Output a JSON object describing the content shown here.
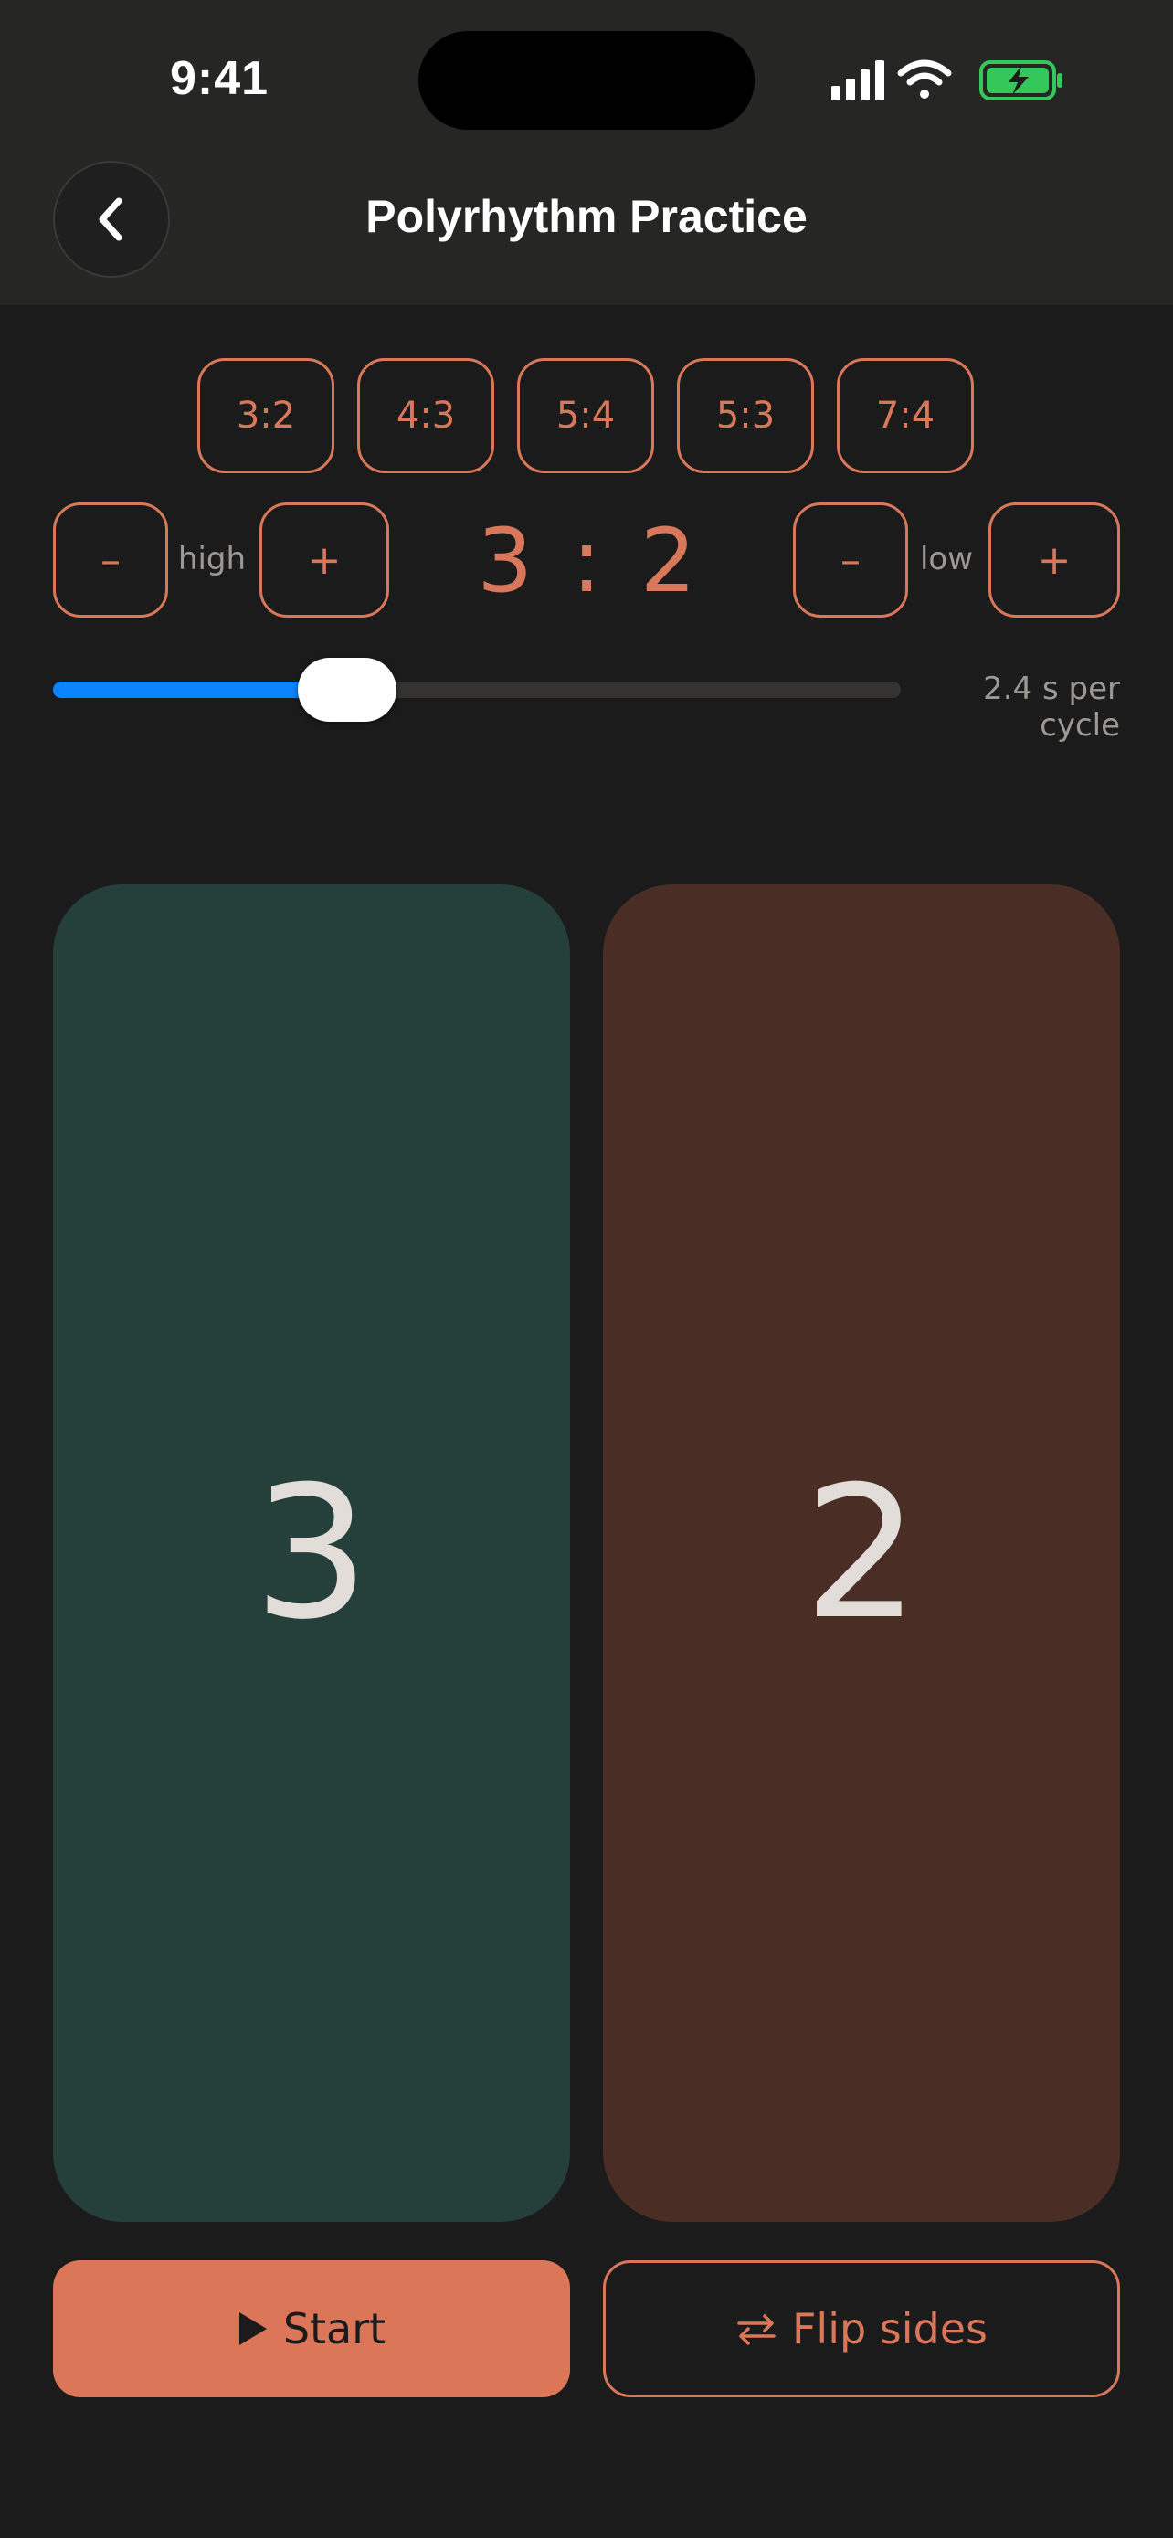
{
  "status_bar": {
    "time": "9:41"
  },
  "header": {
    "title": "Polyrhythm Practice",
    "back_icon": "chevron-left-icon"
  },
  "presets": [
    "3:2",
    "4:3",
    "5:4",
    "5:3",
    "7:4"
  ],
  "high_stepper": {
    "minus": "–",
    "label": "high",
    "plus": "+"
  },
  "low_stepper": {
    "minus": "–",
    "label": "low",
    "plus": "+"
  },
  "ratio": {
    "display": "3 : 2"
  },
  "tempo_slider": {
    "value_fraction": 0.3,
    "readout": "2.4 s per cycle"
  },
  "pads": {
    "high_value": "3",
    "low_value": "2"
  },
  "actions": {
    "start_label": "Start",
    "start_icon": "play-icon",
    "flip_label": "Flip sides",
    "flip_icon": "swap-arrows-icon"
  },
  "colors": {
    "accent": "#d9775a",
    "slider_fill": "#0a84ff",
    "high_pad": "#253f3b",
    "low_pad": "#4a2d25",
    "battery": "#34c759"
  }
}
